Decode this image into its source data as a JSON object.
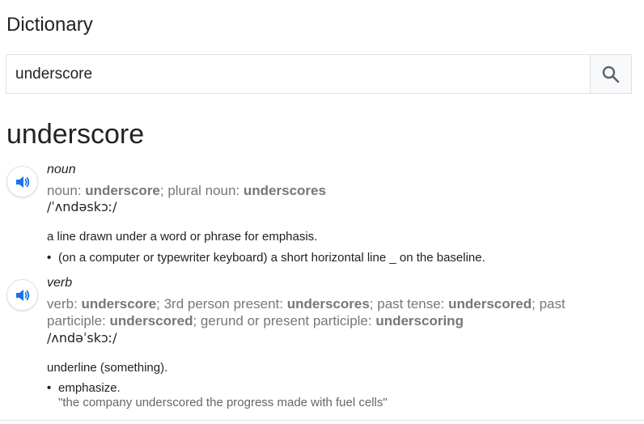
{
  "panel": {
    "title": "Dictionary"
  },
  "search": {
    "value": "underscore",
    "button_icon": "search-icon"
  },
  "headword": "underscore",
  "entries": [
    {
      "pos": "noun",
      "forms": [
        {
          "label": "noun: ",
          "word": "underscore",
          "sep": "; "
        },
        {
          "label": "plural noun: ",
          "word": "underscores",
          "sep": ""
        }
      ],
      "phonetic": "/ˈʌndəskɔː/",
      "definition": "a line drawn under a word or phrase for emphasis.",
      "subdefinition": "(on a computer or typewriter keyboard) a short horizontal line _ on the baseline."
    },
    {
      "pos": "verb",
      "forms": [
        {
          "label": "verb: ",
          "word": "underscore",
          "sep": "; "
        },
        {
          "label": "3rd person present: ",
          "word": "underscores",
          "sep": "; "
        },
        {
          "label": "past tense: ",
          "word": "underscored",
          "sep": "; "
        },
        {
          "label": "past participle: ",
          "word": "underscored",
          "sep": "; "
        },
        {
          "label": "gerund or present participle: ",
          "word": "underscoring",
          "sep": ""
        }
      ],
      "phonetic": "/ʌndəˈskɔː/",
      "definition": "underline (something).",
      "subdefinition": "emphasize.",
      "example": "\"the company underscored the progress made with fuel cells\""
    }
  ],
  "colors": {
    "border": "#dfe1e5",
    "muted_text": "#777777",
    "speaker_blue": "#1a73e8"
  }
}
